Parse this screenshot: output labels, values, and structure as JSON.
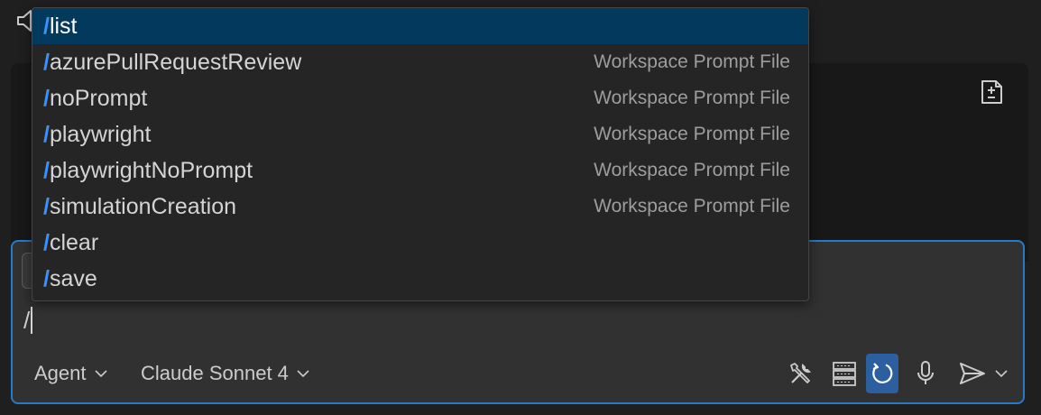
{
  "colors": {
    "accent": "#3794ff",
    "selection": "#04395e",
    "focus_border": "#2a79c9",
    "active_button": "#2c5fa0"
  },
  "suggestions": [
    {
      "slash": "/",
      "command": "list",
      "description": ""
    },
    {
      "slash": "/",
      "command": "azurePullRequestReview",
      "description": "Workspace Prompt File"
    },
    {
      "slash": "/",
      "command": "noPrompt",
      "description": "Workspace Prompt File"
    },
    {
      "slash": "/",
      "command": "playwright",
      "description": "Workspace Prompt File"
    },
    {
      "slash": "/",
      "command": "playwrightNoPrompt",
      "description": "Workspace Prompt File"
    },
    {
      "slash": "/",
      "command": "simulationCreation",
      "description": "Workspace Prompt File"
    },
    {
      "slash": "/",
      "command": "clear",
      "description": ""
    },
    {
      "slash": "/",
      "command": "save",
      "description": ""
    }
  ],
  "input": {
    "value": "/"
  },
  "footer": {
    "mode_label": "Agent",
    "model_label": "Claude Sonnet 4"
  },
  "icons": {
    "top_left": "speaker-icon",
    "panel_action": "new-prompt-file-icon",
    "tools": "tools-icon",
    "context": "server-icon",
    "auto_approve": "refresh-icon",
    "voice": "microphone-icon",
    "send": "send-icon",
    "send_menu": "chevron-down-icon"
  }
}
